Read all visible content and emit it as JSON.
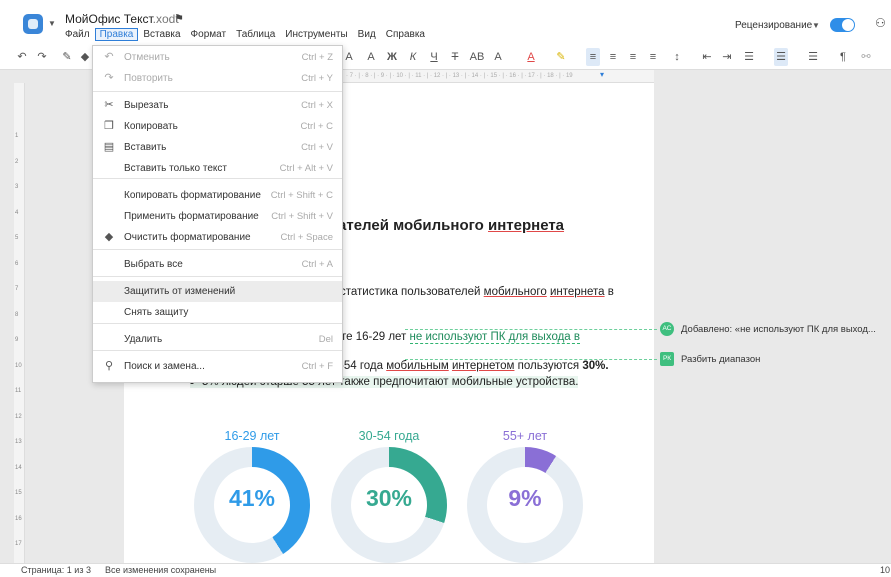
{
  "app": {
    "title": "МойОфис Текст",
    "extension": ".xodt",
    "flag_icon": "flag-icon",
    "review_label": "Рецензирование",
    "review_toggle_on": true
  },
  "menu": [
    "Файл",
    "Правка",
    "Вставка",
    "Формат",
    "Таблица",
    "Инструменты",
    "Вид",
    "Справка"
  ],
  "toolbar_glyphs": {
    "font_grow": "A",
    "font_shrink": "A",
    "bold": "Ж",
    "italic": "К",
    "underline": "Ч",
    "strike": "Т",
    "caps": "АВ",
    "case": "А",
    "font_color": "А",
    "paragraph": "¶"
  },
  "edit_menu": {
    "items": [
      {
        "label": "Отменить",
        "shortcut": "Ctrl + Z",
        "icon": "undo-icon",
        "glyph": "↶",
        "disabled": true
      },
      {
        "label": "Повторить",
        "shortcut": "Ctrl + Y",
        "icon": "redo-icon",
        "glyph": "↷",
        "disabled": true
      },
      {
        "label": "Вырезать",
        "shortcut": "Ctrl + X",
        "icon": "scissors-icon",
        "glyph": "✂",
        "disabled": false
      },
      {
        "label": "Копировать",
        "shortcut": "Ctrl + C",
        "icon": "copy-icon",
        "glyph": "❐",
        "disabled": false
      },
      {
        "label": "Вставить",
        "shortcut": "Ctrl + V",
        "icon": "paste-icon",
        "glyph": "▤",
        "disabled": false
      },
      {
        "label": "Вставить только текст",
        "shortcut": "Ctrl + Alt + V",
        "icon": "",
        "glyph": "",
        "disabled": false
      },
      {
        "label": "Копировать форматирование",
        "shortcut": "Ctrl + Shift + C",
        "icon": "",
        "glyph": "",
        "disabled": false
      },
      {
        "label": "Применить форматирование",
        "shortcut": "Ctrl + Shift + V",
        "icon": "",
        "glyph": "",
        "disabled": false
      },
      {
        "label": "Очистить форматирование",
        "shortcut": "Ctrl + Space",
        "icon": "eraser-icon",
        "glyph": "◆",
        "disabled": false
      },
      {
        "label": "Выбрать все",
        "shortcut": "Ctrl + A",
        "icon": "",
        "glyph": "",
        "disabled": false
      },
      {
        "label": "Защитить от изменений",
        "shortcut": "",
        "icon": "",
        "glyph": "",
        "disabled": false
      },
      {
        "label": "Снять защиту",
        "shortcut": "",
        "icon": "",
        "glyph": "",
        "disabled": false
      },
      {
        "label": "Удалить",
        "shortcut": "Del",
        "icon": "",
        "glyph": "",
        "disabled": false
      },
      {
        "label": "Поиск и замена...",
        "shortcut": "Ctrl + F",
        "icon": "search-icon",
        "glyph": "⚲",
        "disabled": false
      }
    ]
  },
  "document": {
    "heading_a": "ателей мобильного ",
    "heading_b": "интернета",
    "line1_a": "статистика пользователей ",
    "line1_b": "мобильного",
    "line1_c": " ",
    "line1_d": "интернета",
    "line1_e": " в",
    "line2_a": "те 16-29 лет ",
    "line2_added": "не используют ПК для выхода в",
    "line3_a": "-54 года ",
    "line3_b": "мобильным",
    "line3_c": " ",
    "line3_d": "интернетом",
    "line3_e": " пользуются ",
    "line3_bold": "30%.",
    "line4": "5% людей старше 55 лет также предпочитают мобильные устройства."
  },
  "chart_data": {
    "type": "pie",
    "title": "",
    "categories": [
      "16-29 лет",
      "30-54 года",
      "55+ лет"
    ],
    "values": [
      41,
      30,
      9
    ],
    "value_labels": [
      "41%",
      "30%",
      "9%"
    ],
    "colors": [
      "#2f9be8",
      "#36a991",
      "#8a6fd6"
    ],
    "track_color": "#e6edf3"
  },
  "comments": [
    {
      "badge": "АС",
      "text": "Добавлено: «не используют ПК для выход..."
    },
    {
      "badge": "РК",
      "text": "Разбить диапазон"
    }
  ],
  "status": {
    "page": "Страница: 1 из 3",
    "saved": "Все изменения сохранены",
    "zoom": "10"
  },
  "ruler": {
    "marks": "· 7 · | · 8 · | · 9 · | · 10 · | · 11 · | · 12 · | · 13 · | · 14 · | · 15 · | · 16 · | · 17 · | · 18 · | · 19"
  },
  "vruler": [
    "1",
    "2",
    "3",
    "4",
    "5",
    "6",
    "7",
    "8",
    "9",
    "10",
    "11",
    "12",
    "13",
    "14",
    "15",
    "16",
    "17"
  ]
}
